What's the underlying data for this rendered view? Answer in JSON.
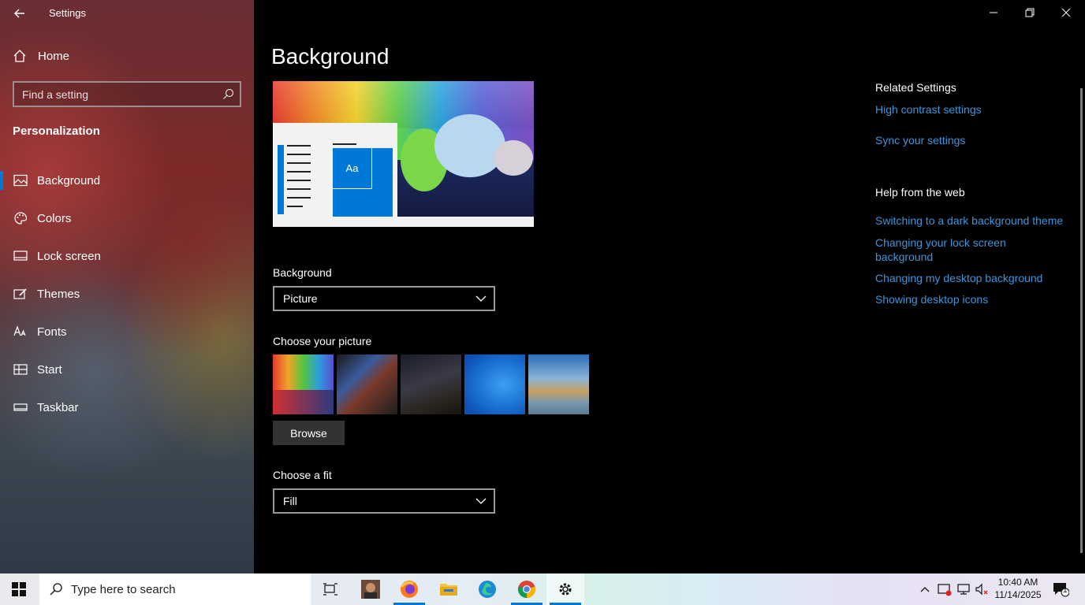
{
  "app": {
    "title": "Settings"
  },
  "sidebar": {
    "home_label": "Home",
    "search_placeholder": "Find a setting",
    "section": "Personalization",
    "items": [
      {
        "label": "Background",
        "icon": "image-icon",
        "active": true
      },
      {
        "label": "Colors",
        "icon": "palette-icon"
      },
      {
        "label": "Lock screen",
        "icon": "lock-screen-icon"
      },
      {
        "label": "Themes",
        "icon": "brush-icon"
      },
      {
        "label": "Fonts",
        "icon": "font-icon"
      },
      {
        "label": "Start",
        "icon": "start-icon"
      },
      {
        "label": "Taskbar",
        "icon": "taskbar-icon"
      }
    ]
  },
  "main": {
    "title": "Background",
    "preview_tile_text": "Aa",
    "background_label": "Background",
    "background_value": "Picture",
    "choose_picture_label": "Choose your picture",
    "browse_label": "Browse",
    "fit_label": "Choose a fit",
    "fit_value": "Fill"
  },
  "related": {
    "heading": "Related Settings",
    "links": [
      "High contrast settings",
      "Sync your settings"
    ]
  },
  "help": {
    "heading": "Help from the web",
    "links": [
      "Switching to a dark background theme",
      "Changing your lock screen background",
      "Changing my desktop background",
      "Showing desktop icons"
    ]
  },
  "taskbar": {
    "search_placeholder": "Type here to search",
    "time": "10:40 AM",
    "date": "11/14/2025",
    "notification_count": "1"
  },
  "colors": {
    "accent": "#0078d7",
    "link": "#3a96dd"
  }
}
